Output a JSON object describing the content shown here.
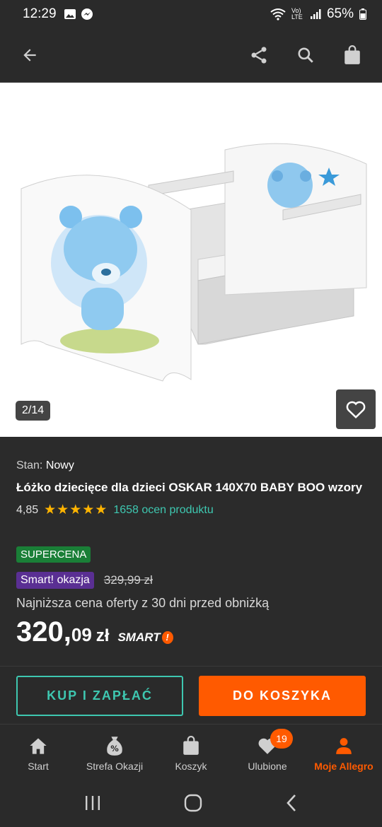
{
  "status": {
    "time": "12:29",
    "battery": "65%",
    "net_label": "Vo) LTE"
  },
  "image": {
    "counter": "2/14"
  },
  "product": {
    "condition_label": "Stan:",
    "condition_value": "Nowy",
    "title": "Łóżko dziecięce dla dzieci OSKAR 140X70 BABY BOO wzory",
    "rating": "4,85",
    "stars": 5,
    "reviews": "1658 ocen produktu",
    "badge_supercena": "SUPERCENA",
    "badge_smart": "Smart! okazja",
    "old_price": "329,99 zł",
    "lowest_price_note": "Najniższa cena oferty z 30 dni przed obniżką",
    "price_int": "320,",
    "price_dec": "09",
    "currency": "zł",
    "smart_logo": "SMART"
  },
  "actions": {
    "buy": "KUP I ZAPŁAĆ",
    "cart": "DO KOSZYKA"
  },
  "nav": {
    "items": [
      {
        "label": "Start",
        "icon": "home-icon"
      },
      {
        "label": "Strefa Okazji",
        "icon": "percent-bag-icon"
      },
      {
        "label": "Koszyk",
        "icon": "bag-icon"
      },
      {
        "label": "Ulubione",
        "icon": "heart-icon",
        "badge": "19"
      },
      {
        "label": "Moje Allegro",
        "icon": "person-icon"
      }
    ]
  },
  "colors": {
    "accent": "#ff5a00",
    "teal": "#3ec7b0",
    "star": "#ffb400",
    "green_badge": "#1a7f37",
    "purple_badge": "#5a2f93"
  }
}
